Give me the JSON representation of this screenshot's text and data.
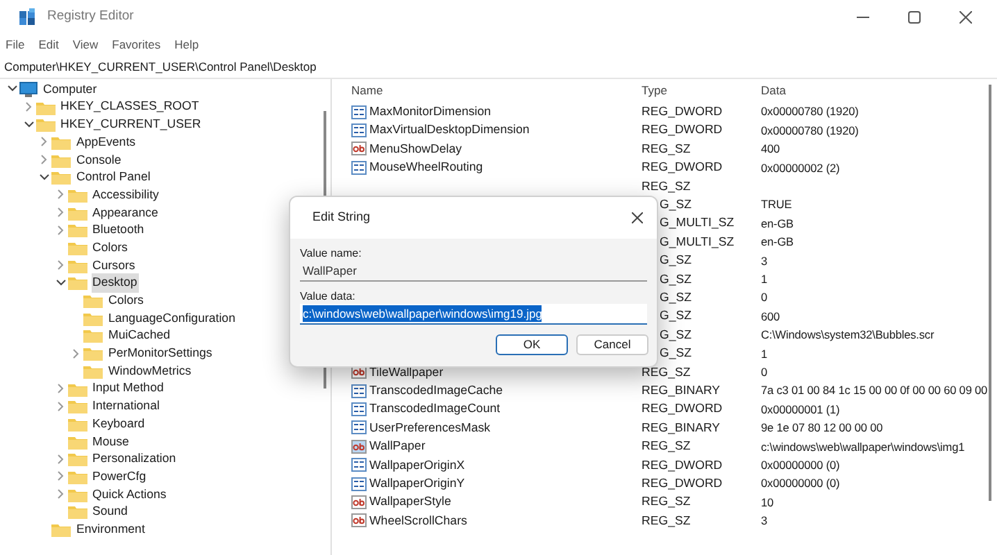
{
  "window": {
    "title": "Registry Editor"
  },
  "menu": [
    "File",
    "Edit",
    "View",
    "Favorites",
    "Help"
  ],
  "address": "Computer\\HKEY_CURRENT_USER\\Control Panel\\Desktop",
  "tree": [
    {
      "label": "Computer",
      "kind": "computer",
      "expanded": true,
      "selected": false,
      "children": [
        {
          "label": "HKEY_CLASSES_ROOT",
          "expanded": false,
          "selected": false
        },
        {
          "label": "HKEY_CURRENT_USER",
          "expanded": true,
          "selected": false,
          "children": [
            {
              "label": "AppEvents",
              "expanded": false,
              "selected": false
            },
            {
              "label": "Console",
              "expanded": false,
              "selected": false
            },
            {
              "label": "Control Panel",
              "expanded": true,
              "selected": false,
              "children": [
                {
                  "label": "Accessibility",
                  "expanded": false,
                  "selected": false
                },
                {
                  "label": "Appearance",
                  "expanded": false,
                  "selected": false
                },
                {
                  "label": "Bluetooth",
                  "expanded": false,
                  "selected": false
                },
                {
                  "label": "Colors",
                  "selected": false
                },
                {
                  "label": "Cursors",
                  "expanded": false,
                  "selected": false
                },
                {
                  "label": "Desktop",
                  "expanded": true,
                  "selected": true,
                  "children": [
                    {
                      "label": "Colors",
                      "selected": false
                    },
                    {
                      "label": "LanguageConfiguration",
                      "selected": false
                    },
                    {
                      "label": "MuiCached",
                      "selected": false
                    },
                    {
                      "label": "PerMonitorSettings",
                      "expanded": false,
                      "selected": false
                    },
                    {
                      "label": "WindowMetrics",
                      "selected": false
                    }
                  ]
                },
                {
                  "label": "Input Method",
                  "expanded": false,
                  "selected": false
                },
                {
                  "label": "International",
                  "expanded": false,
                  "selected": false
                },
                {
                  "label": "Keyboard",
                  "selected": false
                },
                {
                  "label": "Mouse",
                  "selected": false
                },
                {
                  "label": "Personalization",
                  "expanded": false,
                  "selected": false
                },
                {
                  "label": "PowerCfg",
                  "expanded": false,
                  "selected": false
                },
                {
                  "label": "Quick Actions",
                  "expanded": false,
                  "selected": false
                },
                {
                  "label": "Sound",
                  "selected": false
                }
              ]
            },
            {
              "label": "Environment",
              "selected": false
            }
          ]
        }
      ]
    }
  ],
  "table": {
    "columns": [
      "Name",
      "Type",
      "Data"
    ],
    "rows": [
      {
        "kind": "binary",
        "name": "MaxMonitorDimension",
        "type": "REG_DWORD",
        "data": "0x00000780 (1920)",
        "selected": false
      },
      {
        "kind": "binary",
        "name": "MaxVirtualDesktopDimension",
        "type": "REG_DWORD",
        "data": "0x00000780 (1920)",
        "selected": false
      },
      {
        "kind": "string",
        "name": "MenuShowDelay",
        "type": "REG_SZ",
        "data": "400",
        "selected": false
      },
      {
        "kind": "binary",
        "name": "MouseWheelRouting",
        "type": "REG_DWORD",
        "data": "0x00000002 (2)",
        "selected": false
      },
      {
        "kind": "partial",
        "type": "REG_SZ",
        "selected": false
      },
      {
        "kind": "covered",
        "type": "G_SZ",
        "data": "TRUE",
        "selected": false
      },
      {
        "kind": "covered",
        "type": "G_MULTI_SZ",
        "data": "en-GB",
        "selected": false
      },
      {
        "kind": "covered",
        "type": "G_MULTI_SZ",
        "data": "en-GB",
        "selected": false
      },
      {
        "kind": "covered",
        "type": "G_SZ",
        "data": "3",
        "selected": false
      },
      {
        "kind": "covered",
        "type": "G_SZ",
        "data": "1",
        "selected": false
      },
      {
        "kind": "covered",
        "type": "G_SZ",
        "data": "0",
        "selected": false
      },
      {
        "kind": "covered",
        "type": "G_SZ",
        "data": "600",
        "selected": false
      },
      {
        "kind": "covered",
        "type": "G_SZ",
        "data": "C:\\Windows\\system32\\Bubbles.scr",
        "selected": false
      },
      {
        "kind": "covered",
        "type": "G_SZ",
        "data": "1",
        "selected": false
      },
      {
        "kind": "string",
        "name": "TileWallpaper",
        "type": "REG_SZ",
        "data": "0",
        "selected": false
      },
      {
        "kind": "binary",
        "name": "TranscodedImageCache",
        "type": "REG_BINARY",
        "data": "7a c3 01 00 84 1c 15 00 00 0f 00 00 60 09 00",
        "selected": false
      },
      {
        "kind": "binary",
        "name": "TranscodedImageCount",
        "type": "REG_DWORD",
        "data": "0x00000001 (1)",
        "selected": false
      },
      {
        "kind": "binary",
        "name": "UserPreferencesMask",
        "type": "REG_BINARY",
        "data": "9e 1e 07 80 12 00 00 00",
        "selected": false
      },
      {
        "kind": "string",
        "name": "WallPaper",
        "type": "REG_SZ",
        "data": "c:\\windows\\web\\wallpaper\\windows\\img1",
        "selected": true
      },
      {
        "kind": "binary",
        "name": "WallpaperOriginX",
        "type": "REG_DWORD",
        "data": "0x00000000 (0)",
        "selected": false
      },
      {
        "kind": "binary",
        "name": "WallpaperOriginY",
        "type": "REG_DWORD",
        "data": "0x00000000 (0)",
        "selected": false
      },
      {
        "kind": "string",
        "name": "WallpaperStyle",
        "type": "REG_SZ",
        "data": "10",
        "selected": false
      },
      {
        "kind": "string",
        "name": "WheelScrollChars",
        "type": "REG_SZ",
        "data": "3",
        "selected": false
      }
    ]
  },
  "dialog": {
    "title": "Edit String",
    "name_label": "Value name:",
    "name_value": "WallPaper",
    "data_label": "Value data:",
    "data_value": "c:\\windows\\web\\wallpaper\\windows\\img19.jpg",
    "data_selected": true,
    "buttons": [
      {
        "label": "OK",
        "default": true
      },
      {
        "label": "Cancel",
        "default": false
      }
    ]
  }
}
